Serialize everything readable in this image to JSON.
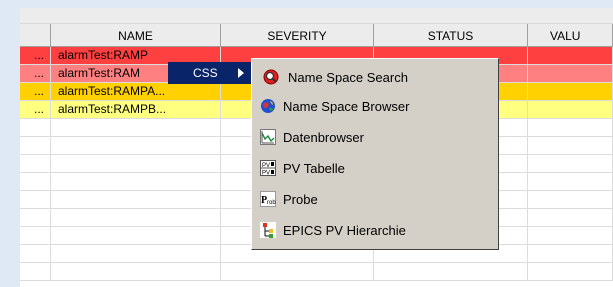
{
  "table": {
    "columns": [
      "",
      "NAME",
      "SEVERITY",
      "STATUS",
      "VALU"
    ],
    "rows": [
      {
        "cells": [
          "...",
          "alarmTest:RAMP",
          "",
          "",
          ""
        ],
        "color": "#ff4040"
      },
      {
        "cells": [
          "...",
          "alarmTest:RAM",
          "",
          "",
          ""
        ],
        "color": "#ff8080"
      },
      {
        "cells": [
          "...",
          "alarmTest:RAMPA...",
          "",
          "",
          ""
        ],
        "color": "#ffd100"
      },
      {
        "cells": [
          "...",
          "alarmTest:RAMPB...",
          "",
          "",
          ""
        ],
        "color": "#ffff80"
      }
    ],
    "empty_rows": 9
  },
  "context_menu": {
    "css_label": "CSS",
    "items": [
      {
        "label": "Name Space Search",
        "icon": "name-space-search-icon"
      },
      {
        "label": "Name Space Browser",
        "icon": "name-space-browser-icon"
      },
      {
        "label": "Datenbrowser",
        "icon": "datenbrowser-icon"
      },
      {
        "label": "PV Tabelle",
        "icon": "pv-tabelle-icon"
      },
      {
        "label": "Probe",
        "icon": "probe-icon"
      },
      {
        "label": "EPICS PV Hierarchie",
        "icon": "epics-pv-hierarchie-icon"
      }
    ]
  },
  "colors": {
    "major": "#ff4040",
    "major_light": "#ff8080",
    "minor": "#ffd100",
    "minor_light": "#ffff80",
    "selection": "#0a246a",
    "menu_bg": "#d4d0c8"
  }
}
